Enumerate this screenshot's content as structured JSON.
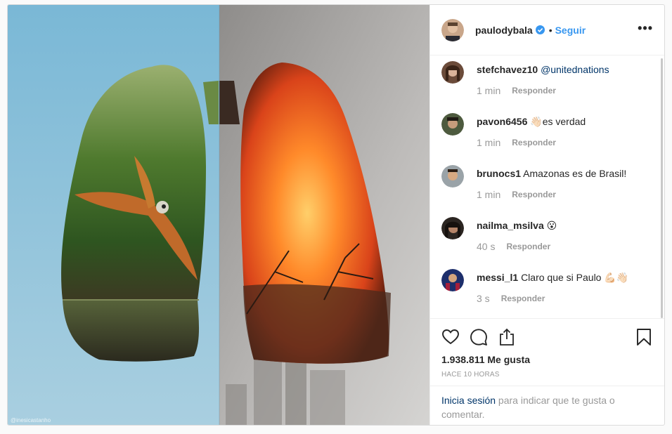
{
  "header": {
    "username": "paulodybala",
    "separator": "•",
    "follow_label": "Seguir",
    "more_label": "•••"
  },
  "image": {
    "watermark": "@inesicastanho"
  },
  "comments": [
    {
      "username": "stefchavez10",
      "text": "",
      "mention": "@unitednations",
      "time": "1 min",
      "reply": "Responder"
    },
    {
      "username": "pavon6456",
      "text": "👋🏻es verdad",
      "mention": "",
      "time": "1 min",
      "reply": "Responder"
    },
    {
      "username": "brunocs1",
      "text": "Amazonas es de Brasil!",
      "mention": "",
      "time": "1 min",
      "reply": "Responder"
    },
    {
      "username": "nailma_msilva",
      "text": "😮",
      "mention": "",
      "time": "40 s",
      "reply": "Responder"
    },
    {
      "username": "messi_l1",
      "text": "Claro que si Paulo 💪🏻👋🏻",
      "mention": "",
      "time": "3 s",
      "reply": "Responder"
    }
  ],
  "likes": "1.938.811 Me gusta",
  "posted_ago": "HACE 10 HORAS",
  "login_prompt": {
    "link": "Inicia sesión",
    "rest": " para indicar que te gusta o comentar."
  },
  "icons": {
    "like": "heart-icon",
    "comment": "comment-bubble-icon",
    "share": "share-icon",
    "save": "bookmark-icon",
    "verified": "verified-badge-icon"
  },
  "colors": {
    "accent": "#3897f0",
    "link": "#003569",
    "muted": "#999999",
    "sky": "#7fb6d0",
    "smoke": "#b5b3b1"
  }
}
